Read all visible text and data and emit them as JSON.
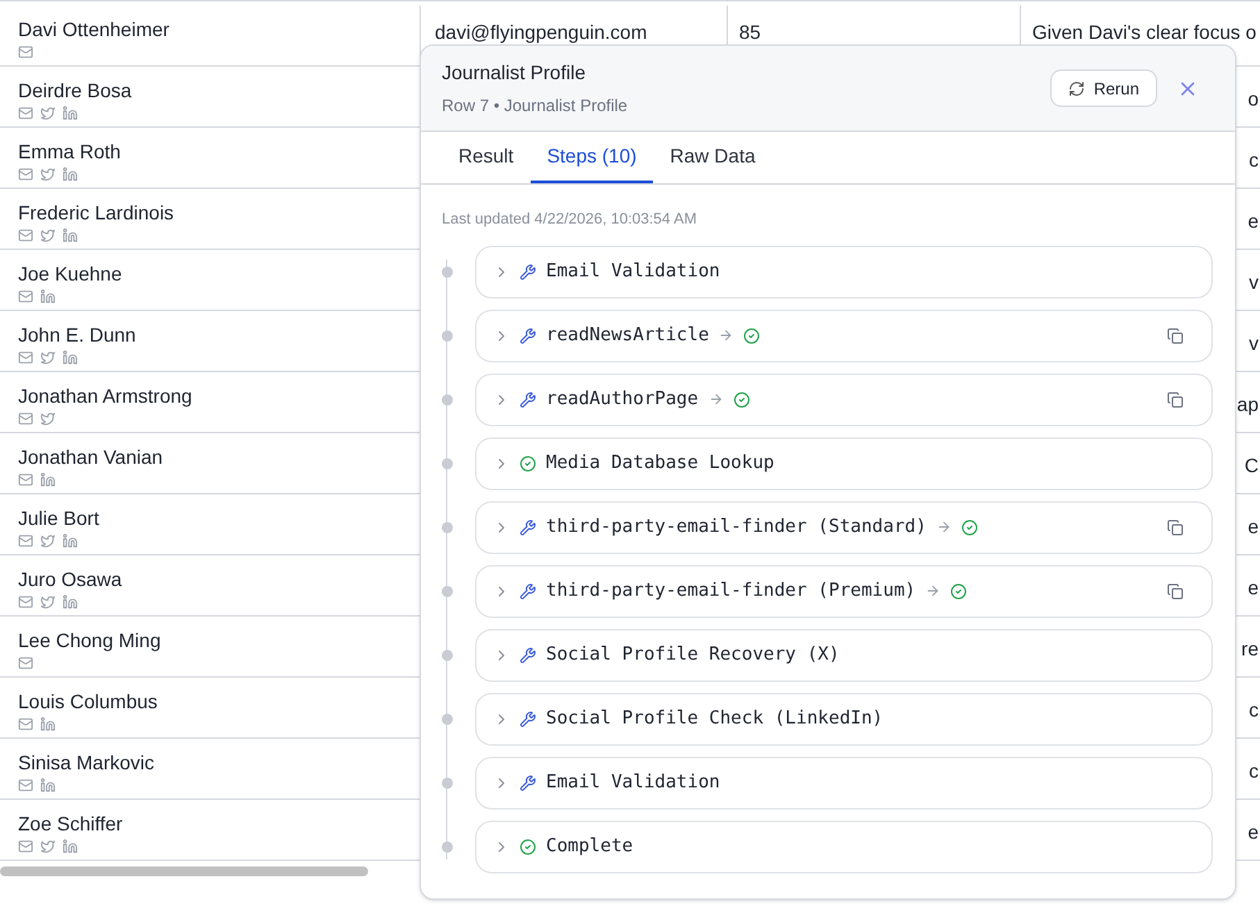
{
  "table": {
    "rows": [
      {
        "name": "Davi Ottenheimer",
        "email_icon": true,
        "twitter_icon": false,
        "linkedin_icon": false,
        "email": "davi@flyingpenguin.com",
        "score": "85",
        "notes": "Given Davi's clear focus o"
      },
      {
        "name": "Deirdre Bosa",
        "email_icon": true,
        "twitter_icon": true,
        "linkedin_icon": true,
        "notes": "o"
      },
      {
        "name": "Emma Roth",
        "email_icon": true,
        "twitter_icon": true,
        "linkedin_icon": true,
        "notes": "c"
      },
      {
        "name": "Frederic Lardinois",
        "email_icon": true,
        "twitter_icon": true,
        "linkedin_icon": true,
        "notes": "e"
      },
      {
        "name": "Joe Kuehne",
        "email_icon": true,
        "twitter_icon": false,
        "linkedin_icon": true,
        "notes": "v"
      },
      {
        "name": "John E. Dunn",
        "email_icon": true,
        "twitter_icon": true,
        "linkedin_icon": true,
        "notes": "v"
      },
      {
        "name": "Jonathan Armstrong",
        "email_icon": true,
        "twitter_icon": true,
        "linkedin_icon": false,
        "notes": "ap"
      },
      {
        "name": "Jonathan Vanian",
        "email_icon": true,
        "twitter_icon": false,
        "linkedin_icon": true,
        "notes": "C"
      },
      {
        "name": "Julie Bort",
        "email_icon": true,
        "twitter_icon": true,
        "linkedin_icon": true,
        "notes": "e"
      },
      {
        "name": "Juro Osawa",
        "email_icon": true,
        "twitter_icon": true,
        "linkedin_icon": true,
        "notes": "e"
      },
      {
        "name": "Lee Chong Ming",
        "email_icon": true,
        "twitter_icon": false,
        "linkedin_icon": false,
        "notes": "re"
      },
      {
        "name": "Louis Columbus",
        "email_icon": true,
        "twitter_icon": false,
        "linkedin_icon": true,
        "notes": "c"
      },
      {
        "name": "Sinisa Markovic",
        "email_icon": true,
        "twitter_icon": false,
        "linkedin_icon": true,
        "notes": "c"
      },
      {
        "name": "Zoe Schiffer",
        "email_icon": true,
        "twitter_icon": true,
        "linkedin_icon": true,
        "notes": "e"
      }
    ]
  },
  "panel": {
    "title": "Journalist Profile",
    "subtitle": "Row 7 • Journalist Profile",
    "rerun_button": "Rerun",
    "tabs": [
      {
        "label": "Result",
        "selected": false
      },
      {
        "label": "Steps (10)",
        "selected": true
      },
      {
        "label": "Raw Data",
        "selected": false
      }
    ],
    "last_updated": "Last updated 4/22/2026, 10:03:54 AM",
    "steps": [
      {
        "label": "Email Validation",
        "kind": "tool",
        "succeeded": false,
        "copyable": false
      },
      {
        "label": "readNewsArticle",
        "kind": "tool",
        "succeeded": true,
        "copyable": true
      },
      {
        "label": "readAuthorPage",
        "kind": "tool",
        "succeeded": true,
        "copyable": true
      },
      {
        "label": "Media Database Lookup",
        "kind": "done",
        "succeeded": false,
        "copyable": false
      },
      {
        "label": "third-party-email-finder (Standard)",
        "kind": "tool",
        "succeeded": true,
        "copyable": true
      },
      {
        "label": "third-party-email-finder (Premium)",
        "kind": "tool",
        "succeeded": true,
        "copyable": true
      },
      {
        "label": "Social Profile Recovery (X)",
        "kind": "tool",
        "succeeded": false,
        "copyable": false
      },
      {
        "label": "Social Profile Check (LinkedIn)",
        "kind": "tool",
        "succeeded": false,
        "copyable": false
      },
      {
        "label": "Email Validation",
        "kind": "tool",
        "succeeded": false,
        "copyable": false
      },
      {
        "label": "Complete",
        "kind": "done",
        "succeeded": false,
        "copyable": false
      }
    ]
  }
}
